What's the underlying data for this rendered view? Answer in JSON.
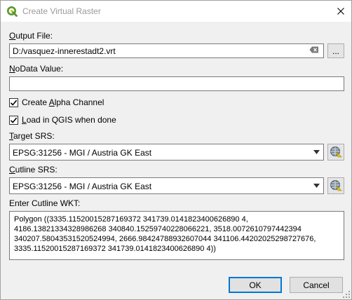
{
  "window": {
    "title": "Create Virtual Raster",
    "close_glyph": "✕"
  },
  "output": {
    "label_first": "O",
    "label_rest": "utput File:",
    "value": "D:/vasquez-innerestadt2.vrt",
    "browse_label": "..."
  },
  "nodata": {
    "label_first": "N",
    "label_rest": "oData Value:",
    "value": ""
  },
  "alpha": {
    "label_pre": "Create ",
    "label_accel": "A",
    "label_post": "lpha Channel",
    "checked": true
  },
  "load": {
    "label_accel": "L",
    "label_rest": "oad in QGIS when done",
    "checked": true
  },
  "target_srs": {
    "label_first": "T",
    "label_rest": "arget SRS:",
    "value": "EPSG:31256 - MGI / Austria GK East"
  },
  "cutline_srs": {
    "label_first": "C",
    "label_rest": "utline SRS:",
    "value": "EPSG:31256 - MGI / Austria GK East"
  },
  "cutline_wkt": {
    "label": "Enter Cutline WKT:",
    "value": "Polygon ((3335.11520015287169372 341739.0141823400626890 4, 4186.13821334328986268 340840.15259740228066221, 3518.0072610797442394 340207.58043531520524994, 2666.98424788932607044 341106.44202025298727676, 3335.11520015287169372 341739.0141823400626890 4))"
  },
  "buttons": {
    "ok": "OK",
    "cancel": "Cancel"
  },
  "colors": {
    "qgis_green": "#589632",
    "qgis_yellow": "#f0c808",
    "accent": "#0078d7"
  },
  "icons": {
    "app": "qgis-logo-icon",
    "close": "close-icon",
    "clear": "clear-text-icon",
    "projection": "projection-selector-icon",
    "dropdown": "chevron-down-icon"
  }
}
